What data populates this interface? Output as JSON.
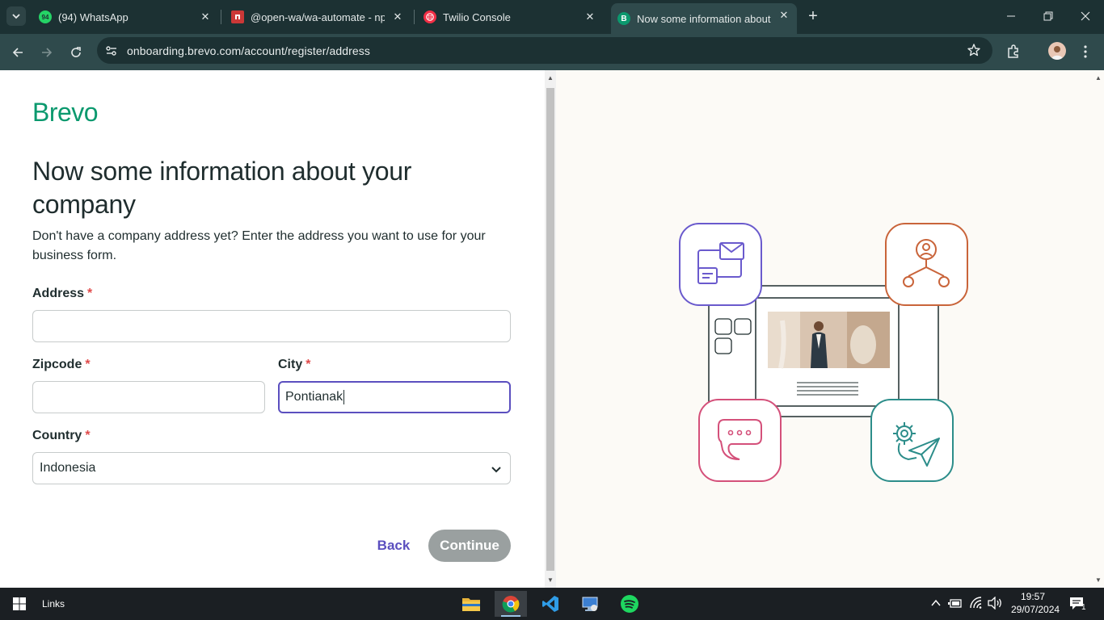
{
  "browser": {
    "tabs": [
      {
        "title": "(94) WhatsApp",
        "badge": "94",
        "icon": "whatsapp-icon",
        "color": "#25d366"
      },
      {
        "title": "@open-wa/wa-automate - npm",
        "icon": "npm-icon",
        "color": "#cb3837"
      },
      {
        "title": "Twilio Console",
        "icon": "twilio-icon",
        "color": "#f22f46"
      },
      {
        "title": "Now some information about your company",
        "icon": "brevo-icon",
        "letter": "B",
        "color": "#0b996e"
      }
    ],
    "url": "onboarding.brevo.com/account/register/address"
  },
  "page": {
    "logo": "Brevo",
    "title": "Now some information about your company",
    "subtitle": "Don't have a company address yet? Enter the address you want to use for your business form.",
    "required_mark": "*",
    "address": {
      "label": "Address",
      "value": ""
    },
    "zipcode": {
      "label": "Zipcode",
      "value": ""
    },
    "city": {
      "label": "City",
      "value": "Pontianak"
    },
    "country": {
      "label": "Country",
      "value": "Indonesia"
    },
    "back_label": "Back",
    "continue_label": "Continue"
  },
  "illustration": {
    "colors": {
      "purple": "#6a5acd",
      "orange": "#c9643a",
      "pink": "#d4507a",
      "teal": "#2c8d8a"
    }
  },
  "taskbar": {
    "links_label": "Links",
    "time": "19:57",
    "date": "29/07/2024",
    "notification_count": "1"
  }
}
